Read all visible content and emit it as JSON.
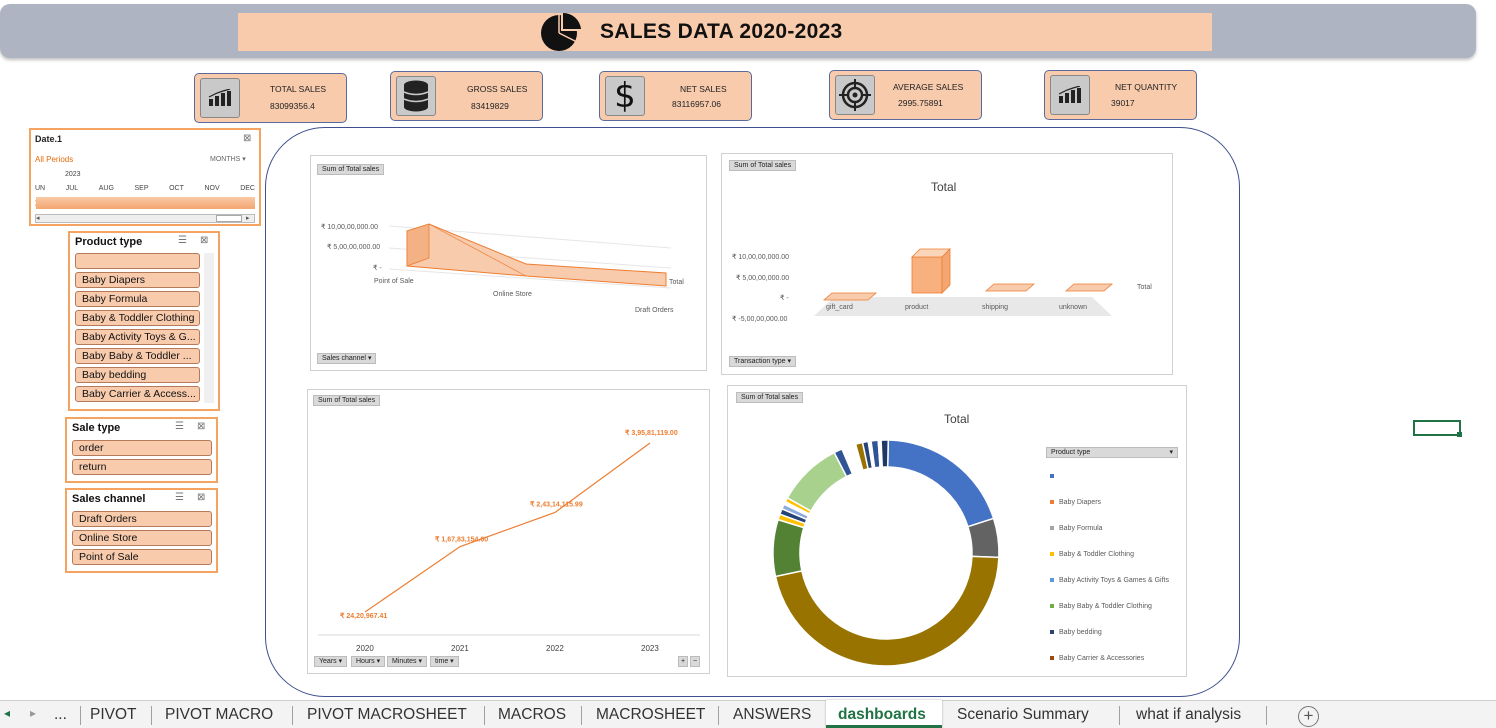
{
  "header": {
    "title": "SALES DATA 2020-2023"
  },
  "kpis": [
    {
      "label": "TOTAL SALES",
      "value": "83099356.4",
      "icon": "bar-chart-icon"
    },
    {
      "label": "GROSS SALES",
      "value": "83419829",
      "icon": "database-icon"
    },
    {
      "label": "NET SALES",
      "value": "83116957.06",
      "icon": "dollar-icon"
    },
    {
      "label": "AVERAGE SALES",
      "value": "2995.75891",
      "icon": "target-icon"
    },
    {
      "label": "NET QUANTITY",
      "value": "39017",
      "icon": "bar-chart-icon"
    }
  ],
  "timeline": {
    "title": "Date.1",
    "period": "All Periods",
    "level": "MONTHS",
    "year": "2023",
    "months": [
      "UN",
      "JUL",
      "AUG",
      "SEP",
      "OCT",
      "NOV",
      "DEC"
    ]
  },
  "slicers": {
    "product_type": {
      "title": "Product type",
      "items": [
        "",
        "Baby Diapers",
        "Baby Formula",
        "Baby & Toddler Clothing",
        "Baby Activity Toys & G...",
        "Baby Baby & Toddler ...",
        "Baby bedding",
        "Baby Carrier & Access..."
      ]
    },
    "sale_type": {
      "title": "Sale type",
      "items": [
        "order",
        "return"
      ]
    },
    "sales_channel": {
      "title": "Sales channel",
      "items": [
        "Draft Orders",
        "Online Store",
        "Point of Sale"
      ]
    }
  },
  "chart_data": [
    {
      "type": "area",
      "field_button": "Sum of Total sales",
      "filter_button": "Sales channel",
      "categories": [
        "Point of Sale",
        "Online Store",
        "Draft Orders"
      ],
      "series": [
        {
          "name": "Total",
          "values": [
            95000000,
            30000000,
            1000000
          ]
        }
      ],
      "ytick_labels": [
        "₹ 10,00,00,000.00",
        "₹ 5,00,00,000.00",
        "₹ -"
      ],
      "ylim": [
        0,
        100000000
      ]
    },
    {
      "type": "bar",
      "field_button": "Sum of Total sales",
      "filter_button": "Transaction type",
      "title": "Total",
      "categories": [
        "gift_card",
        "product",
        "shipping",
        "unknown"
      ],
      "series": [
        {
          "name": "Total",
          "values": [
            0,
            83000000,
            200000,
            0
          ]
        }
      ],
      "ytick_labels": [
        "₹ 10,00,00,000.00",
        "₹ 5,00,00,000.00",
        "₹ -",
        "₹ -5,00,00,000.00"
      ],
      "ylim": [
        -50000000,
        100000000
      ]
    },
    {
      "type": "line",
      "field_button": "Sum of Total sales",
      "filter_buttons": [
        "Years",
        "Hours",
        "Minutes",
        "time"
      ],
      "categories": [
        "2020",
        "2021",
        "2022",
        "2023"
      ],
      "values": [
        2420967.41,
        16783154.0,
        24314115.99,
        39581119.0
      ],
      "data_labels": [
        "₹ 24,20,967.41",
        "₹ 1,67,83,154.00",
        "₹ 2,43,14,115.99",
        "₹ 3,95,81,119.00"
      ],
      "color": "#ed7d31"
    },
    {
      "type": "pie",
      "field_button": "Sum of Total sales",
      "legend_button": "Product type",
      "title": "Total",
      "legend": [
        "",
        "Baby Diapers",
        "Baby Formula",
        "Baby & Toddler Clothing",
        "Baby Activity Toys & Games & Gifts",
        "Baby Baby & Toddler Clothing",
        "Baby bedding",
        "Baby Carrier & Accessories"
      ],
      "slices": [
        {
          "value": 19.5,
          "color": "#4472c4"
        },
        {
          "value": 5.5,
          "color": "#636363"
        },
        {
          "value": 45.5,
          "color": "#997300"
        },
        {
          "value": 8.0,
          "color": "#548235"
        },
        {
          "value": 0.8,
          "color": "#ffc000"
        },
        {
          "value": 0.8,
          "color": "#264478"
        },
        {
          "value": 0.7,
          "color": "#8faadc"
        },
        {
          "value": 0.4,
          "color": "#ffffff"
        },
        {
          "value": 0.6,
          "color": "#ffc000"
        },
        {
          "value": 9.2,
          "color": "#a9d18e"
        },
        {
          "value": 1.2,
          "color": "#2f5597"
        },
        {
          "value": 2.0,
          "color": "#ffffff"
        },
        {
          "value": 1.0,
          "color": "#997300"
        },
        {
          "value": 0.8,
          "color": "#264478"
        },
        {
          "value": 0.4,
          "color": "#ffffff"
        },
        {
          "value": 1.0,
          "color": "#2f5597"
        },
        {
          "value": 0.4,
          "color": "#ffffff"
        },
        {
          "value": 1.0,
          "color": "#203864"
        }
      ],
      "legend_colors": [
        "#4472c4",
        "#ed7d31",
        "#a5a5a5",
        "#ffc000",
        "#5b9bd5",
        "#70ad47",
        "#264478",
        "#9e480e"
      ]
    }
  ],
  "tabs": [
    "...",
    "PIVOT",
    "PIVOT MACRO",
    "PIVOT MACROSHEET",
    "MACROS",
    "MACROSHEET",
    "ANSWERS",
    "dashboards",
    "Scenario Summary",
    "what if analysis"
  ],
  "active_tab": "dashboards",
  "colors": {
    "accent": "#f8cbad",
    "slicer_border": "#f4a460",
    "line": "#ed7d31",
    "active_tab": "#217346"
  }
}
